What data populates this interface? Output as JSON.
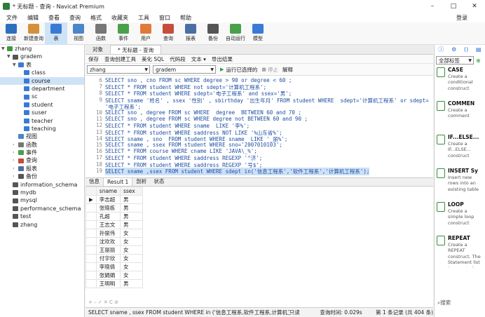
{
  "window": {
    "title": "* 无标题 - 查询 - Navicat Premium",
    "min": "–",
    "max": "□",
    "close": "✕"
  },
  "menu": [
    "文件",
    "编辑",
    "查看",
    "查询",
    "格式",
    "收藏夹",
    "工具",
    "窗口",
    "帮助"
  ],
  "login": "登录",
  "toolbar": [
    {
      "label": "连接",
      "color": "#2c6fbf"
    },
    {
      "label": "新建查询",
      "color": "#d5903a"
    },
    {
      "label": "表",
      "color": "#3a7ad6",
      "active": true
    },
    {
      "label": "视图",
      "color": "#4a86c9"
    },
    {
      "label": "函数",
      "color": "#777777"
    },
    {
      "label": "事件",
      "color": "#4aa14a"
    },
    {
      "label": "用户",
      "color": "#e07a3a"
    },
    {
      "label": "查询",
      "color": "#c54d3a"
    },
    {
      "label": "报表",
      "color": "#4a6fa5"
    },
    {
      "label": "备份",
      "color": "#555555"
    },
    {
      "label": "自动运行",
      "color": "#4aa14a"
    },
    {
      "label": "模型",
      "color": "#3a7ad6"
    }
  ],
  "tree": [
    {
      "label": "zhang",
      "lvl": 0,
      "arr": "▼",
      "color": "#3a9b3a"
    },
    {
      "label": "gradem",
      "lvl": 1,
      "arr": "▼",
      "color": "#555"
    },
    {
      "label": "表",
      "lvl": 2,
      "arr": "▼",
      "color": "#3a7ad6"
    },
    {
      "label": "class",
      "lvl": 3,
      "arr": "",
      "color": "#3a7ad6"
    },
    {
      "label": "course",
      "lvl": 3,
      "arr": "",
      "color": "#3a7ad6",
      "sel": true
    },
    {
      "label": "department",
      "lvl": 3,
      "arr": "",
      "color": "#3a7ad6"
    },
    {
      "label": "sc",
      "lvl": 3,
      "arr": "",
      "color": "#3a7ad6"
    },
    {
      "label": "student",
      "lvl": 3,
      "arr": "",
      "color": "#3a7ad6"
    },
    {
      "label": "suser",
      "lvl": 3,
      "arr": "",
      "color": "#3a7ad6"
    },
    {
      "label": "teacher",
      "lvl": 3,
      "arr": "",
      "color": "#3a7ad6"
    },
    {
      "label": "teaching",
      "lvl": 3,
      "arr": "",
      "color": "#3a7ad6"
    },
    {
      "label": "视图",
      "lvl": 2,
      "arr": "",
      "color": "#4a86c9"
    },
    {
      "label": "函数",
      "lvl": 2,
      "arr": "›",
      "color": "#777"
    },
    {
      "label": "事件",
      "lvl": 2,
      "arr": "›",
      "color": "#4aa14a"
    },
    {
      "label": "查询",
      "lvl": 2,
      "arr": "›",
      "color": "#c54d3a"
    },
    {
      "label": "报表",
      "lvl": 2,
      "arr": "›",
      "color": "#4a6fa5"
    },
    {
      "label": "备份",
      "lvl": 2,
      "arr": "›",
      "color": "#555"
    },
    {
      "label": "information_schema",
      "lvl": 1,
      "arr": "",
      "color": "#555"
    },
    {
      "label": "mydb",
      "lvl": 1,
      "arr": "",
      "color": "#555"
    },
    {
      "label": "mysql",
      "lvl": 1,
      "arr": "",
      "color": "#555"
    },
    {
      "label": "performance_schema",
      "lvl": 1,
      "arr": "",
      "color": "#555"
    },
    {
      "label": "test",
      "lvl": 1,
      "arr": "",
      "color": "#555"
    },
    {
      "label": "zhang",
      "lvl": 1,
      "arr": "",
      "color": "#555"
    }
  ],
  "tabs": {
    "objects": "对象",
    "query": "* 无标题 - 查询"
  },
  "qtool": [
    "保存",
    "查询创建工具",
    "美化 SQL",
    "代码段",
    "文本 ▾",
    "导出结果"
  ],
  "conn": "zhang",
  "db": "gradem",
  "run": {
    "run": "运行已选择的",
    "stop": "停止",
    "explain": "解释"
  },
  "code": [
    {
      "n": "6",
      "t": "SELECT sno , cno FROM sc WHERE degree > 90 or degree < 60 ;"
    },
    {
      "n": "7",
      "t": "SELECT * FROM student WHERE not sdept='计算机工程系';"
    },
    {
      "n": "8",
      "t": "SELECT * FROM student WHERE sdept='电子工程系' and ssex='男';"
    },
    {
      "n": "9",
      "t": "SELECT sname '姓名' , ssex '性别' , sbirthday '出生年月' FROM student WHERE  sdept='计算机工程系' or sdept="
    },
    {
      "n": "",
      "t": "'电子工程系';"
    },
    {
      "n": "10",
      "t": "SELECT sno , degree FROM sc WHERE  degree  BETWEEN 60 and 70 ;"
    },
    {
      "n": "11",
      "t": "SELECT sno , degree FROM sc WHERE degree not BETWEEN 60 and 90 ;"
    },
    {
      "n": "12",
      "t": "SELECT * FROM student WHERE sname  LIKE '李%';"
    },
    {
      "n": "13",
      "t": "SELECT * FROM student WHERE saddress NOT LIKE '%山东省%';"
    },
    {
      "n": "14",
      "t": "SELECT sname , sno  FROM student WHERE sname  LIKE '_丽%';"
    },
    {
      "n": "15",
      "t": "SELECT sname , ssex FROM student WHERE sno='2007010103';"
    },
    {
      "n": "16",
      "t": "SELECT * FROM course WHERE cname LIKE 'JAVA\\_%';"
    },
    {
      "n": "17",
      "t": "SELECT * FROM student WHERE saddress REGEXP '^济';"
    },
    {
      "n": "18",
      "t": "SELECT * FROM student WHERE saddress REGEXP '号$';"
    },
    {
      "n": "19",
      "t": "SELECT sname ,ssex FROM student WHERE sdept in('信息工程系','软件工程系','计算机工程系');"
    }
  ],
  "rtabs": [
    "信息",
    "Result 1",
    "剖析",
    "状态"
  ],
  "cols": [
    "sname",
    "ssex"
  ],
  "rows": [
    [
      "李志超",
      "男"
    ],
    [
      "张晓栋",
      "男"
    ],
    [
      "孔超",
      "男"
    ],
    [
      "王志文",
      "男"
    ],
    [
      "孙丽伟",
      "女"
    ],
    [
      "沈欢欢",
      "女"
    ],
    [
      "王丽丽",
      "女"
    ],
    [
      "付宇欣",
      "女"
    ],
    [
      "李晓倩",
      "女"
    ],
    [
      "张娟娟",
      "女"
    ],
    [
      "王明明",
      "男"
    ]
  ],
  "gridnav": "+ – ✓ ✕ C ⊘",
  "status": {
    "sql": "SELECT sname , ssex FROM student WHERE in ('信息工程系,软件工程系,计算机工程系'",
    "mode": "只读",
    "time": "查询时间: 0.029s",
    "rec": "第 1 条记录 (共 404 条)"
  },
  "rpanel": {
    "filter": "全部标签",
    "search": "搜索"
  },
  "snippets": [
    {
      "title": "CASE",
      "desc": "Create a conditional construct"
    },
    {
      "title": "COMMEN",
      "desc": "Create a comment"
    },
    {
      "title": "IF...ELSE...",
      "desc": "Create a IF...ELSE... construct"
    },
    {
      "title": "INSERT Sy",
      "desc": "Insert new rows into an existing table"
    },
    {
      "title": "LOOP",
      "desc": "Create a simple loop construct"
    },
    {
      "title": "REPEAT",
      "desc": "Create a REPEAT construct. The Statement list is repeated until the search_cond expression is true."
    }
  ]
}
